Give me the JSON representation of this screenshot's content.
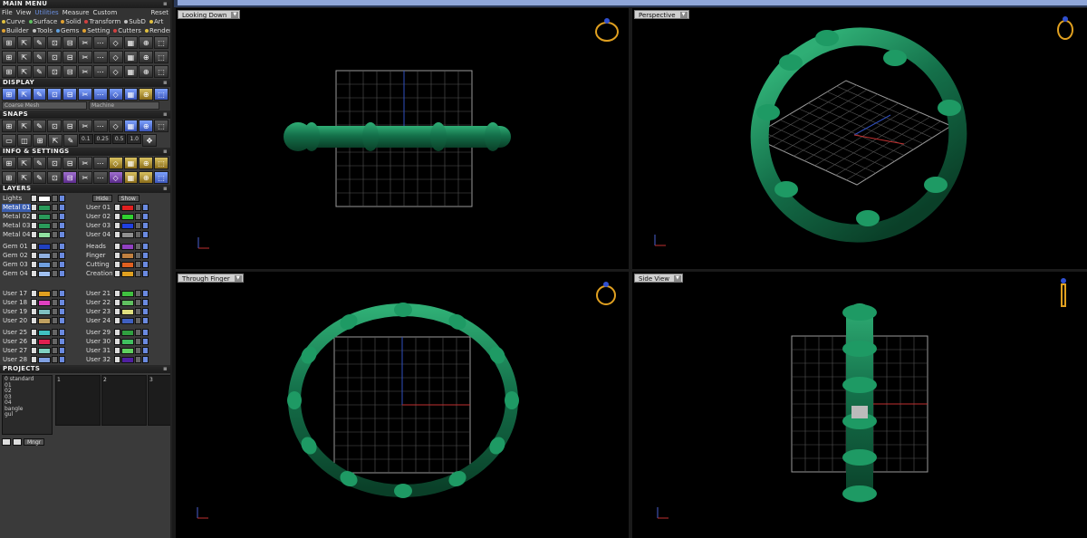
{
  "main_menu": {
    "header": "MAIN MENU",
    "menubar": [
      "File",
      "View",
      "Utilities",
      "Measure",
      "Custom"
    ],
    "reset": "Reset",
    "categories_row1": [
      {
        "label": "Curve",
        "color": "#e0c040"
      },
      {
        "label": "Surface",
        "color": "#60c060"
      },
      {
        "label": "Solid",
        "color": "#e0a030"
      },
      {
        "label": "Transform",
        "color": "#d04040"
      },
      {
        "label": "SubD",
        "color": "#c0c0c0"
      },
      {
        "label": "Art",
        "color": "#e0c040"
      }
    ],
    "categories_row2": [
      {
        "label": "Builder",
        "color": "#e0a030"
      },
      {
        "label": "Tools",
        "color": "#c0c0c0"
      },
      {
        "label": "Gems",
        "color": "#60a0e0"
      },
      {
        "label": "Setting",
        "color": "#e0a030"
      },
      {
        "label": "Cutters",
        "color": "#d04040"
      },
      {
        "label": "Render",
        "color": "#e0c040"
      }
    ]
  },
  "display": {
    "header": "DISPLAY",
    "mesh_dropdown": "Coarse Mesh",
    "machine_dropdown": "Machine"
  },
  "snaps": {
    "header": "SNAPS",
    "values": [
      "0.1",
      "0.25",
      "0.5",
      "1.0"
    ]
  },
  "info": {
    "header": "INFO & SETTINGS"
  },
  "layers": {
    "header": "LAYERS",
    "lights": "Lights",
    "hide": "Hide",
    "show": "Show",
    "groups": [
      {
        "left": [
          {
            "name": "Metal 01",
            "color": "#2a9a5a",
            "selected": true
          },
          {
            "name": "Metal 02",
            "color": "#2a9a5a"
          },
          {
            "name": "Metal 03",
            "color": "#2a9a5a"
          },
          {
            "name": "Metal 04",
            "color": "#90e0a0"
          }
        ],
        "right": [
          {
            "name": "User 01",
            "color": "#e02020"
          },
          {
            "name": "User 02",
            "color": "#30d030"
          },
          {
            "name": "User 03",
            "color": "#2040e0"
          },
          {
            "name": "User 04",
            "color": "#909090"
          }
        ]
      },
      {
        "left": [
          {
            "name": "Gem 01",
            "color": "#2040c0"
          },
          {
            "name": "Gem 02",
            "color": "#90b0e0"
          },
          {
            "name": "Gem 03",
            "color": "#70a0e0"
          },
          {
            "name": "Gem 04",
            "color": "#a0c0f0"
          }
        ],
        "right": [
          {
            "name": "Heads",
            "color": "#9040c0"
          },
          {
            "name": "Finger",
            "color": "#c08040"
          },
          {
            "name": "Cutting",
            "color": "#e06020"
          },
          {
            "name": "Creation",
            "color": "#e0a020"
          }
        ]
      },
      {
        "left": [
          {
            "name": "User 17",
            "color": "#e0a020"
          },
          {
            "name": "User 18",
            "color": "#e040c0"
          },
          {
            "name": "User 19",
            "color": "#80c0c0"
          },
          {
            "name": "User 20",
            "color": "#c0a060"
          }
        ],
        "right": [
          {
            "name": "User 21",
            "color": "#40c040"
          },
          {
            "name": "User 22",
            "color": "#60c060"
          },
          {
            "name": "User 23",
            "color": "#e0e080"
          },
          {
            "name": "User 24",
            "color": "#4060c0"
          }
        ]
      },
      {
        "left": [
          {
            "name": "User 25",
            "color": "#40c0c0"
          },
          {
            "name": "User 26",
            "color": "#e02050"
          },
          {
            "name": "User 27",
            "color": "#80d0c0"
          },
          {
            "name": "User 28",
            "color": "#80a0e0"
          }
        ],
        "right": [
          {
            "name": "User 29",
            "color": "#30a040"
          },
          {
            "name": "User 30",
            "color": "#40c060"
          },
          {
            "name": "User 31",
            "color": "#60d060"
          },
          {
            "name": "User 32",
            "color": "#5020a0"
          }
        ]
      }
    ]
  },
  "projects": {
    "header": "PROJECTS",
    "list": [
      "0 standard",
      "01",
      "02",
      "03",
      "04",
      "bangle",
      "gul"
    ],
    "columns": [
      "1",
      "2",
      "3"
    ],
    "mngr": "Mngr"
  },
  "viewports": [
    {
      "label": "Looking Down"
    },
    {
      "label": "Perspective"
    },
    {
      "label": "Through Finger"
    },
    {
      "label": "Side View"
    }
  ],
  "colors": {
    "ring_green": "#1d8a5a",
    "grid": "#9a9a9a",
    "accent_blue": "#6a8fe0"
  }
}
